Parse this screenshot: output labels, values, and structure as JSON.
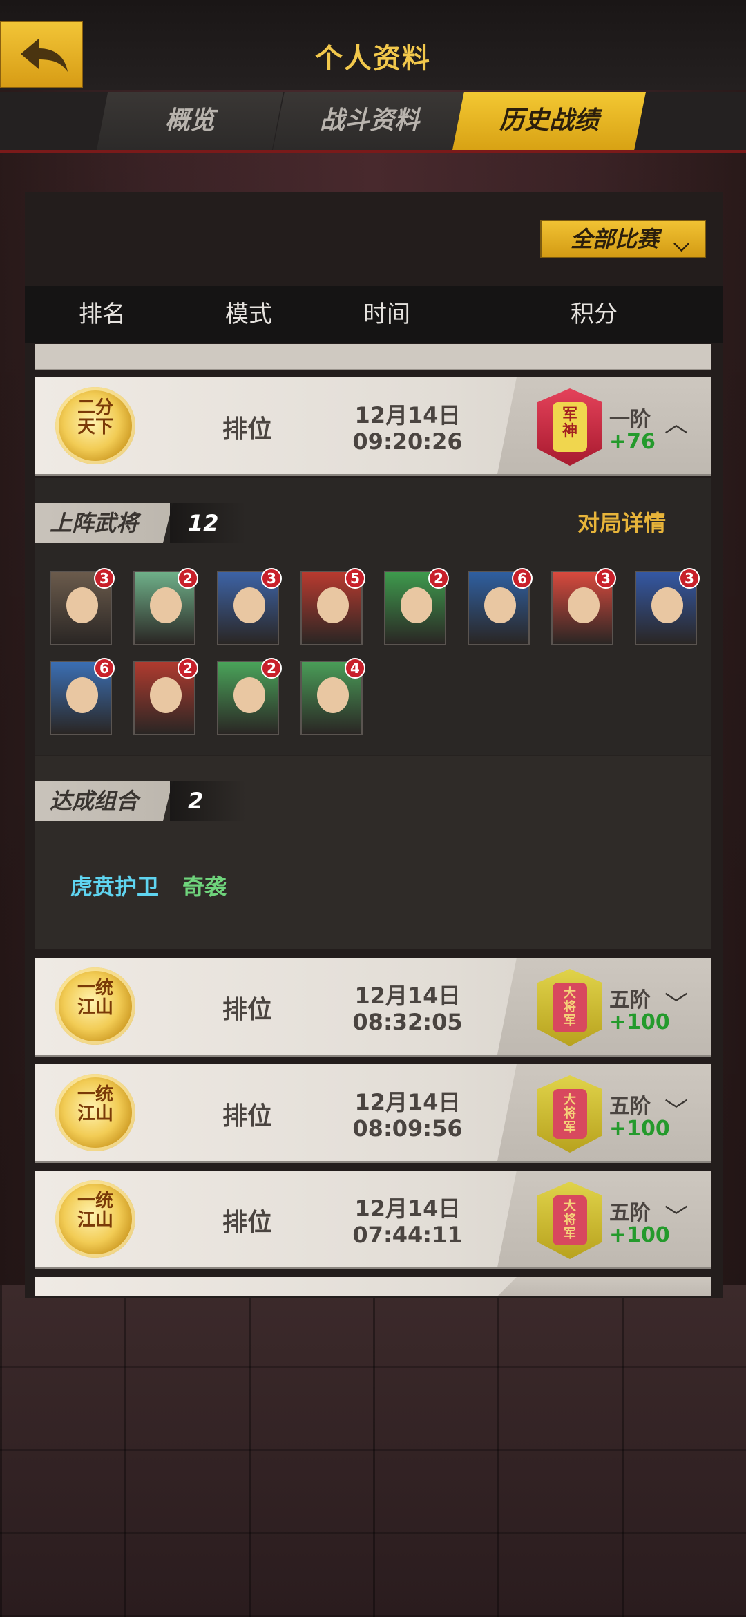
{
  "header": {
    "title": "个人资料"
  },
  "tabs": [
    {
      "label": "概览"
    },
    {
      "label": "战斗资料"
    },
    {
      "label": "历史战绩"
    }
  ],
  "filter": {
    "label": "全部比赛"
  },
  "columns": {
    "rank": "排名",
    "mode": "模式",
    "time": "时间",
    "score": "积分"
  },
  "records": [
    {
      "emblem": "二分\n天下",
      "mode": "排位",
      "date": "12月14日",
      "time": "09:20:26",
      "badge": "军\n神",
      "rank": "一阶",
      "score": "+76",
      "toggle": "^"
    },
    {
      "emblem": "一统\n江山",
      "mode": "排位",
      "date": "12月14日",
      "time": "08:32:05",
      "badge": "大\n将\n军",
      "rank": "五阶",
      "score": "+100",
      "toggle": "v"
    },
    {
      "emblem": "一统\n江山",
      "mode": "排位",
      "date": "12月14日",
      "time": "08:09:56",
      "badge": "大\n将\n军",
      "rank": "五阶",
      "score": "+100",
      "toggle": "v"
    },
    {
      "emblem": "一统\n江山",
      "mode": "排位",
      "date": "12月14日",
      "time": "07:44:11",
      "badge": "大\n将\n军",
      "rank": "五阶",
      "score": "+100",
      "toggle": "v"
    }
  ],
  "detail": {
    "heroes_label": "上阵武将",
    "heroes_count": "12",
    "detail_link": "对局详情",
    "heroes": [
      {
        "level": "3",
        "color": "#6b5b4c"
      },
      {
        "level": "2",
        "color": "#6fb089"
      },
      {
        "level": "3",
        "color": "#3d63a6"
      },
      {
        "level": "5",
        "color": "#b83a2f"
      },
      {
        "level": "2",
        "color": "#3e9a4d"
      },
      {
        "level": "6",
        "color": "#2f5fa0"
      },
      {
        "level": "3",
        "color": "#d94a3e"
      },
      {
        "level": "3",
        "color": "#3458a4"
      },
      {
        "level": "6",
        "color": "#3b6fb4"
      },
      {
        "level": "2",
        "color": "#b03b2f"
      },
      {
        "level": "2",
        "color": "#4aa45a"
      },
      {
        "level": "4",
        "color": "#4a9d58"
      }
    ],
    "combos_label": "达成组合",
    "combos_count": "2",
    "combos": [
      {
        "name": "虎贲护卫",
        "color": "#5fd4f0"
      },
      {
        "name": "奇袭",
        "color": "#6fd47c"
      }
    ]
  }
}
